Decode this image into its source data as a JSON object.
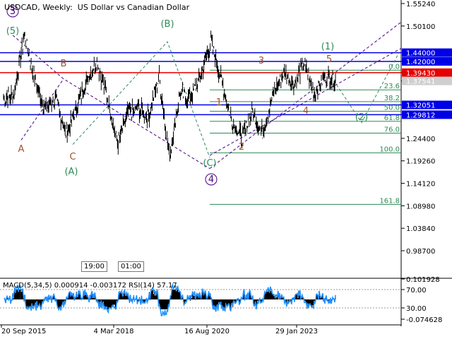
{
  "header": {
    "symbol": "USDCAD",
    "timeframe": "Weekly:",
    "description": "US Dollar vs Canadian Dollar"
  },
  "chart_data": {
    "type": "line",
    "ylim": [
      0.9,
      1.572
    ],
    "y_ticks": [
      "1.55240",
      "1.50100",
      "1.39430",
      "1.37541",
      "1.29812",
      "1.24400",
      "1.19260",
      "1.14120",
      "1.08980",
      "1.03840",
      "0.98700"
    ],
    "x_ticks": [
      "20 Sep 2015",
      "4 Mar 2018",
      "16 Aug 2020",
      "29 Jan 2023"
    ],
    "price_series_anchor_prices": [
      1.335,
      1.342,
      1.48,
      1.38,
      1.31,
      1.335,
      1.255,
      1.31,
      1.375,
      1.42,
      1.34,
      1.23,
      1.305,
      1.31,
      1.295,
      1.385,
      1.2,
      1.345,
      1.335,
      1.385,
      1.465,
      1.38,
      1.285,
      1.245,
      1.305,
      1.255,
      1.345,
      1.395,
      1.365,
      1.415,
      1.345,
      1.385,
      1.375
    ],
    "hlines": [
      {
        "label": "1.44000",
        "price": 1.44,
        "color": "#0000e6"
      },
      {
        "label": "1.42000",
        "price": 1.42,
        "color": "#0000e6"
      },
      {
        "label": "1.39430",
        "price": 1.3943,
        "color": "#e60000"
      },
      {
        "label": "1.32051",
        "price": 1.32051,
        "color": "#0000e6"
      },
      {
        "label": "1.29812",
        "price": 1.29812,
        "color": "#0000e6"
      }
    ],
    "current_price": {
      "label": "1.37541",
      "price": 1.37541
    },
    "fib_levels": [
      {
        "label": "0.0",
        "price": 1.4
      },
      {
        "label": "23.6",
        "price": 1.355
      },
      {
        "label": "38.2",
        "price": 1.328
      },
      {
        "label": "50.0",
        "price": 1.306
      },
      {
        "label": "61.8",
        "price": 1.283
      },
      {
        "label": "76.0",
        "price": 1.256
      },
      {
        "label": "100.0",
        "price": 1.211
      },
      {
        "label": "161.8",
        "price": 1.093
      }
    ],
    "wave_labels": [
      {
        "text": "3",
        "style": "circle",
        "color": "#4b0082"
      },
      {
        "text": "(5)",
        "color": "#2e8b57"
      },
      {
        "text": "B",
        "color": "#a0522d"
      },
      {
        "text": "A",
        "color": "#a0522d"
      },
      {
        "text": "C",
        "color": "#a0522d"
      },
      {
        "text": "(A)",
        "color": "#2e8b57"
      },
      {
        "text": "(B)",
        "color": "#2e8b57"
      },
      {
        "text": "1",
        "color": "#a0522d"
      },
      {
        "text": "2",
        "color": "#a0522d"
      },
      {
        "text": "(C)",
        "color": "#2e8b57"
      },
      {
        "text": "4",
        "style": "circle",
        "color": "#4b0082"
      },
      {
        "text": "3",
        "color": "#a0522d"
      },
      {
        "text": "4",
        "color": "#a0522d"
      },
      {
        "text": "5",
        "color": "#a0522d"
      },
      {
        "text": "(1)",
        "color": "#2e8b57"
      },
      {
        "text": "(2)",
        "color": "#2e8b57"
      }
    ],
    "indicator": {
      "title": "MACD(5,34,5) 0.000914 -0.003172 RSI(14) 57.17",
      "y_ticks": [
        "0.101928",
        "70.00",
        "30.00",
        "-0.074628"
      ]
    },
    "time_boxes": [
      "19:00",
      "01:00"
    ],
    "colors": {
      "price": "#000000",
      "fib": "#2e8b57",
      "wave_green": "#2e8b57",
      "wave_brown": "#a0522d",
      "wave_purple": "#4b0082",
      "level_blue": "#0000e6",
      "level_red": "#e60000",
      "rsi": "#1e90ff",
      "macd": "#000000"
    }
  }
}
